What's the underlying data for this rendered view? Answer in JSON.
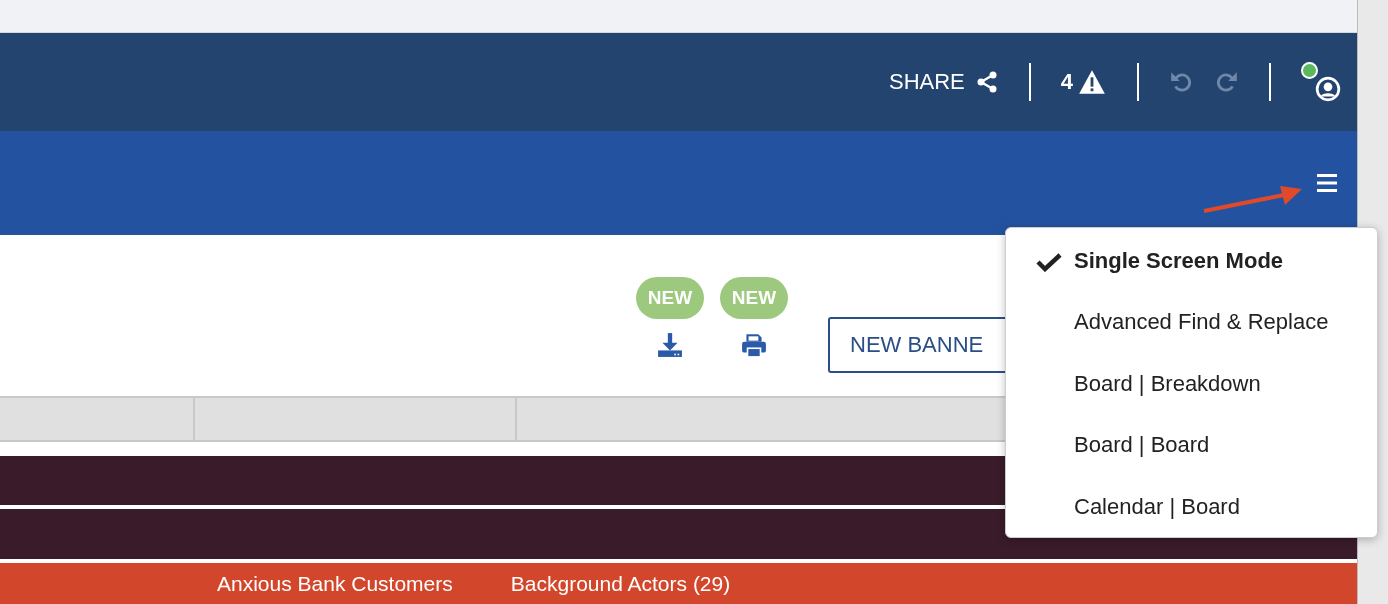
{
  "header": {
    "share_label": "SHARE",
    "warning_count": "4",
    "undo_disabled": true,
    "redo_disabled": true,
    "user_online": true
  },
  "toolbar": {
    "tools": [
      {
        "badge": "NEW",
        "kind": "download"
      },
      {
        "badge": "NEW",
        "kind": "print"
      }
    ],
    "new_banner_button": "NEW BANNE"
  },
  "table": {
    "rows": [
      {
        "color": "#3a1b29"
      },
      {
        "color": "#3a1b29"
      },
      {
        "color": "#d2462b",
        "cells": [
          "Anxious Bank Customers",
          "Background Actors (29)"
        ]
      }
    ]
  },
  "menu": {
    "items": [
      {
        "label": "Single Screen Mode",
        "checked": true
      },
      {
        "label": "Advanced Find & Replace",
        "checked": false
      },
      {
        "label": "Board | Breakdown",
        "checked": false
      },
      {
        "label": "Board | Board",
        "checked": false
      },
      {
        "label": "Calendar | Board",
        "checked": false
      }
    ]
  }
}
